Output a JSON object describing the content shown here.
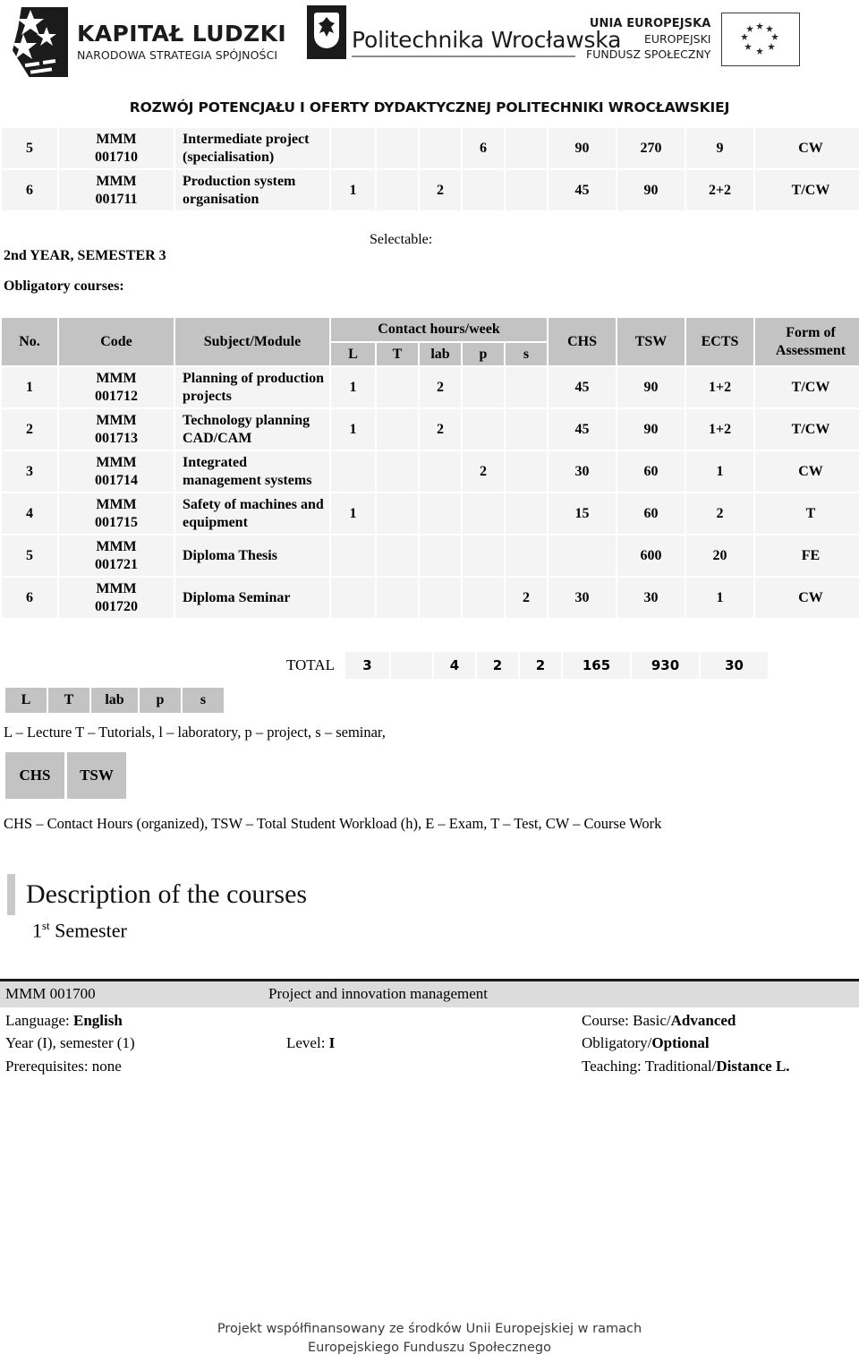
{
  "header": {
    "logos": [
      {
        "name": "kapital-ludzki",
        "title": "KAPITAŁ LUDZKI",
        "subtitle": "NARODOWA STRATEGIA SPÓJNOŚCI"
      },
      {
        "name": "politechnika-wroclawska",
        "title": "Politechnika Wrocławska"
      },
      {
        "name": "unia-europejska",
        "line1": "UNIA EUROPEJSKA",
        "line2": "EUROPEJSKI",
        "line3": "FUNDUSZ SPOŁECZNY"
      }
    ]
  },
  "project_title": "ROZWÓJ POTENCJAŁU I OFERTY DYDAKTYCZNEJ POLITECHNIKI WROCŁAWSKIEJ",
  "top_table": {
    "rows": [
      {
        "no": "5",
        "code_line1": "MMM",
        "code_line2": "001710",
        "subject": "Intermediate project (specialisation)",
        "L": "",
        "T": "",
        "lab": "",
        "p": "6",
        "s": "",
        "CHS": "90",
        "TSW": "270",
        "ECTS": "9",
        "form": "CW"
      },
      {
        "no": "6",
        "code_line1": "MMM",
        "code_line2": "001711",
        "subject": "Production system organisation",
        "L": "1",
        "T": "",
        "lab": "2",
        "p": "",
        "s": "",
        "CHS": "45",
        "TSW": "90",
        "ECTS": "2+2",
        "form": "T/CW"
      }
    ]
  },
  "mid": {
    "selectable": "Selectable:",
    "year_semester": "2nd YEAR, SEMESTER 3",
    "obligatory": "Obligatory courses:"
  },
  "main_table": {
    "headers": {
      "no": "No.",
      "code": "Code",
      "subject": "Subject/Module",
      "contact_hours": "Contact hours/week",
      "L": "L",
      "T": "T",
      "lab": "lab",
      "p": "p",
      "s": "s",
      "CHS": "CHS",
      "TSW": "TSW",
      "ECTS": "ECTS",
      "form": "Form of Assessment"
    },
    "rows": [
      {
        "no": "1",
        "code_line1": "MMM",
        "code_line2": "001712",
        "subject": "Planning of production projects",
        "L": "1",
        "T": "",
        "lab": "2",
        "p": "",
        "s": "",
        "CHS": "45",
        "TSW": "90",
        "ECTS": "1+2",
        "form": "T/CW"
      },
      {
        "no": "2",
        "code_line1": "MMM",
        "code_line2": "001713",
        "subject": "Technology planning CAD/CAM",
        "L": "1",
        "T": "",
        "lab": "2",
        "p": "",
        "s": "",
        "CHS": "45",
        "TSW": "90",
        "ECTS": "1+2",
        "form": "T/CW"
      },
      {
        "no": "3",
        "code_line1": "MMM",
        "code_line2": "001714",
        "subject": "Integrated management systems",
        "L": "",
        "T": "",
        "lab": "",
        "p": "2",
        "s": "",
        "CHS": "30",
        "TSW": "60",
        "ECTS": "1",
        "form": "CW"
      },
      {
        "no": "4",
        "code_line1": "MMM",
        "code_line2": "001715",
        "subject": "Safety of machines and equipment",
        "L": "1",
        "T": "",
        "lab": "",
        "p": "",
        "s": "",
        "CHS": "15",
        "TSW": "60",
        "ECTS": "2",
        "form": "T"
      },
      {
        "no": "5",
        "code_line1": "MMM",
        "code_line2": "001721",
        "subject": "Diploma Thesis",
        "L": "",
        "T": "",
        "lab": "",
        "p": "",
        "s": "",
        "CHS": "",
        "TSW": "600",
        "ECTS": "20",
        "form": "FE"
      },
      {
        "no": "6",
        "code_line1": "MMM",
        "code_line2": "001720",
        "subject": "Diploma Seminar",
        "L": "",
        "T": "",
        "lab": "",
        "p": "",
        "s": "2",
        "CHS": "30",
        "TSW": "30",
        "ECTS": "1",
        "form": "CW"
      }
    ]
  },
  "totals": {
    "label": "TOTAL",
    "L": "3",
    "T": "",
    "lab": "4",
    "p": "2",
    "s": "2",
    "CHS": "165",
    "TSW": "930",
    "ECTS": "30"
  },
  "legend": {
    "chips_row1": [
      "L",
      "T",
      "lab",
      "p",
      "s"
    ],
    "text_row1": "L – Lecture  T – Tutorials, l – laboratory, p – project, s – seminar,",
    "chips_row2": [
      "CHS",
      "TSW"
    ],
    "text_row2": "CHS – Contact Hours (organized),  TSW – Total Student Workload (h), E – Exam, T – Test, CW – Course Work"
  },
  "description": {
    "title": "Description of the courses",
    "semester": "1st Semester",
    "semester_num": "1",
    "semester_sup": "st",
    "semester_rest": " Semester"
  },
  "course_card": {
    "code": "MMM 001700",
    "name": "Project and innovation management",
    "language_label": "Language: ",
    "language_value": "English",
    "course_label": "Course: Basic/",
    "course_value": "Advanced",
    "year_semester": "Year  (I), semester (1)",
    "level_label": "Level: ",
    "level_value": "I",
    "obligatory_label": "Obligatory/",
    "obligatory_value": "Optional",
    "prerequisites": "Prerequisites:  none",
    "teaching_label": "Teaching: Traditional/",
    "teaching_value": "Distance L."
  },
  "footer": {
    "line1": "Projekt współfinansowany ze środków Unii Europejskiej w ramach",
    "line2": "Europejskiego Funduszu Społecznego"
  },
  "colors": {
    "header_cell": "#c3c3c3",
    "body_cell": "#f4f4f4",
    "course_bar": "#dcdcdc",
    "rule": "#1b1b1b"
  }
}
